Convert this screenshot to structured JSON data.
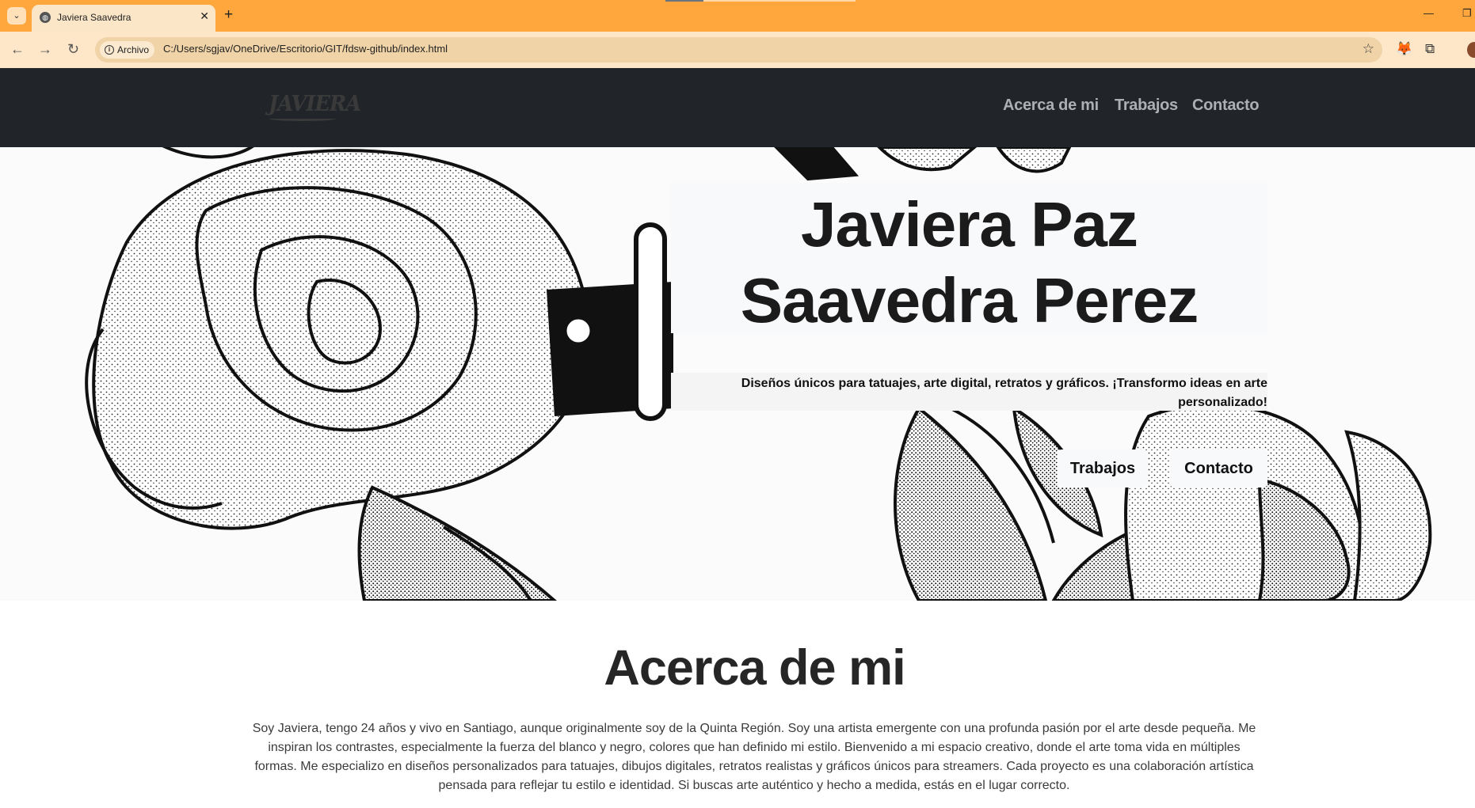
{
  "browser": {
    "tab_title": "Javiera Saavedra",
    "tab_close": "✕",
    "new_tab": "+",
    "tab_menu": "⌄",
    "minimize": "—",
    "restore": "❐",
    "back": "←",
    "forward": "→",
    "reload": "↻",
    "site_info_label": "Archivo",
    "url": "C:/Users/sgjav/OneDrive/Escritorio/GIT/fdsw-github/index.html",
    "bookmark": "☆",
    "extension_icon": "🦊",
    "extensions": "⧉"
  },
  "header": {
    "logo_text": "JAVIERA",
    "nav": [
      {
        "label": "Acerca de mi"
      },
      {
        "label": "Trabajos"
      },
      {
        "label": "Contacto"
      }
    ]
  },
  "hero": {
    "title": "Javiera Paz Saavedra Perez",
    "subtitle": "Diseños únicos para tatuajes, arte digital, retratos y gráficos. ¡Transformo ideas en arte personalizado!",
    "buttons": [
      {
        "label": "Trabajos"
      },
      {
        "label": "Contacto"
      }
    ],
    "background_icon": "rose-illustration"
  },
  "about": {
    "heading": "Acerca de mi",
    "body": "Soy Javiera, tengo 24 años y vivo en Santiago, aunque originalmente soy de la Quinta Región. Soy una artista emergente con una profunda pasión por el arte desde pequeña. Me inspiran los contrastes, especialmente la fuerza del blanco y negro, colores que han definido mi estilo. Bienvenido a mi espacio creativo, donde el arte toma vida en múltiples formas. Me especializo en diseños personalizados para tatuajes, dibujos digitales, retratos realistas y gráficos únicos para streamers. Cada proyecto es una colaboración artística pensada para reflejar tu estilo e identidad. Si buscas arte auténtico y hecho a medida, estás en el lugar correcto."
  },
  "colors": {
    "tabbar": "#ffa63d",
    "toolbar": "#fde7c8",
    "navbar": "#212529",
    "nav_link": "#adafb2",
    "light_box": "#f8f9fa"
  }
}
